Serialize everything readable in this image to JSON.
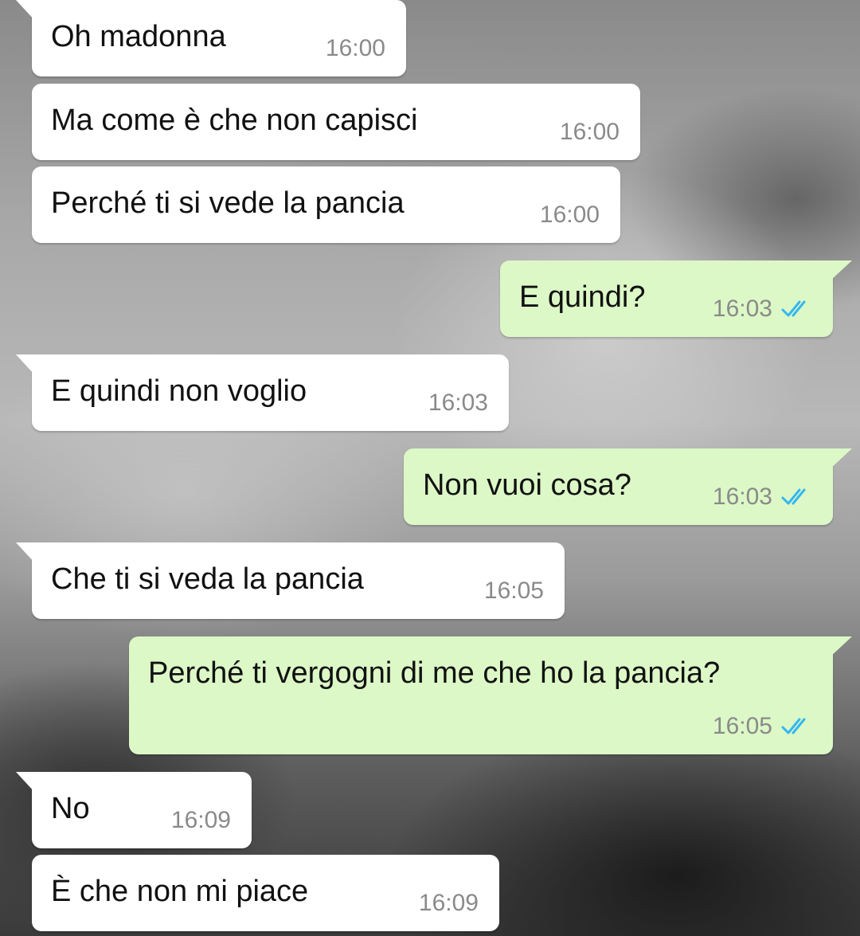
{
  "messages": [
    {
      "text": "Oh madonna",
      "time": "16:00",
      "direction": "incoming"
    },
    {
      "text": "Ma come è che non capisci",
      "time": "16:00",
      "direction": "incoming"
    },
    {
      "text": "Perché ti si vede la pancia",
      "time": "16:00",
      "direction": "incoming"
    },
    {
      "text": "E quindi?",
      "time": "16:03",
      "direction": "outgoing",
      "status": "read-ticks-icon"
    },
    {
      "text": "E quindi non voglio",
      "time": "16:03",
      "direction": "incoming"
    },
    {
      "text": "Non vuoi cosa?",
      "time": "16:03",
      "direction": "outgoing",
      "status": "read-ticks-icon"
    },
    {
      "text": "Che ti si veda la pancia",
      "time": "16:05",
      "direction": "incoming"
    },
    {
      "text": "Perché ti vergogni di me che ho la pancia?",
      "time": "16:05",
      "direction": "outgoing",
      "status": "read-ticks-icon"
    },
    {
      "text": "No",
      "time": "16:09",
      "direction": "incoming"
    },
    {
      "text": "È che non mi piace",
      "time": "16:09",
      "direction": "incoming"
    }
  ],
  "colors": {
    "incoming_bubble": "#ffffff",
    "outgoing_bubble": "#dcf8c6",
    "read_ticks": "#34b7f1",
    "timestamp": "#8a8a8a"
  }
}
